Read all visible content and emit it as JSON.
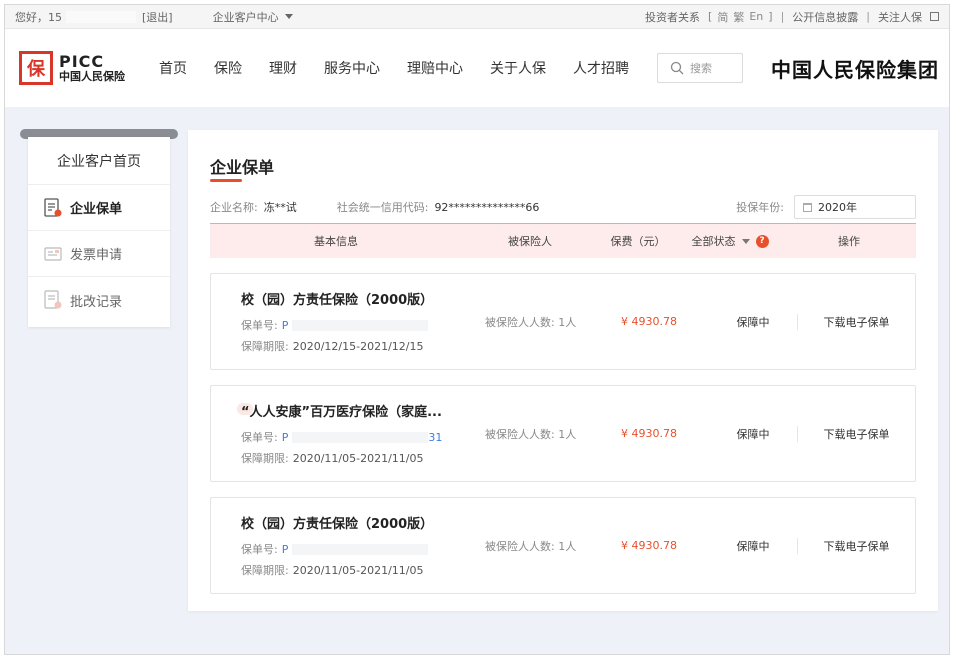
{
  "topbar": {
    "greeting": "您好，15",
    "logout": "[退出]",
    "center_menu": "企业客户中心",
    "investor": "投资者关系",
    "lang_open": "[",
    "lang_simplified": "简",
    "lang_traditional": "繁",
    "lang_english": "En",
    "lang_close": "]",
    "divider": "|",
    "disclosure": "公开信息披露",
    "follow": "关注人保"
  },
  "header": {
    "logo_en": "PICC",
    "logo_cn": "中国人民保险",
    "logo_seal": "保",
    "nav": [
      "首页",
      "保险",
      "理财",
      "服务中心",
      "理赔中心",
      "关于人保",
      "人才招聘"
    ],
    "search_placeholder": "搜索",
    "group_name": "中国人民保险集团"
  },
  "sidebar": {
    "title": "企业客户首页",
    "items": [
      {
        "label": "企业保单",
        "active": true,
        "icon": "policy-doc-icon"
      },
      {
        "label": "发票申请",
        "active": false,
        "icon": "invoice-icon"
      },
      {
        "label": "批改记录",
        "active": false,
        "icon": "record-icon"
      }
    ]
  },
  "main": {
    "title": "企业保单",
    "company_label": "企业名称:",
    "company_value": "冻**试",
    "credit_label": "社会统一信用代码:",
    "credit_value": "92**************66",
    "year_label": "投保年份:",
    "year_value": "2020年",
    "columns": {
      "basic": "基本信息",
      "insured": "被保险人",
      "fee": "保费（元）",
      "status": "全部状态",
      "action": "操作"
    },
    "policies": [
      {
        "name": "校（园）方责任保险（2000版）",
        "no_label": "保单号:",
        "no_value": "P",
        "no_suffix": "",
        "period_label": "保障期限:",
        "period_value": "2020/12/15-2021/12/15",
        "insured": "被保险人人数: 1人",
        "fee": "¥ 4930.78",
        "status": "保障中",
        "action": "下载电子保单"
      },
      {
        "name": "“人人安康”百万医疗保险（家庭...",
        "no_label": "保单号:",
        "no_value": "P",
        "no_suffix": "31",
        "period_label": "保障期限:",
        "period_value": "2020/11/05-2021/11/05",
        "insured": "被保险人人数: 1人",
        "fee": "¥ 4930.78",
        "status": "保障中",
        "action": "下载电子保单"
      },
      {
        "name": "校（园）方责任保险（2000版）",
        "no_label": "保单号:",
        "no_value": "P",
        "no_suffix": "",
        "period_label": "保障期限:",
        "period_value": "2020/11/05-2021/11/05",
        "insured": "被保险人人数: 1人",
        "fee": "¥ 4930.78",
        "status": "保障中",
        "action": "下载电子保单"
      }
    ]
  },
  "colors": {
    "brand_red": "#d9362a",
    "accent_orange": "#e8502c",
    "table_head_bg": "#fdeceb",
    "link_blue": "#3d7ee0"
  }
}
